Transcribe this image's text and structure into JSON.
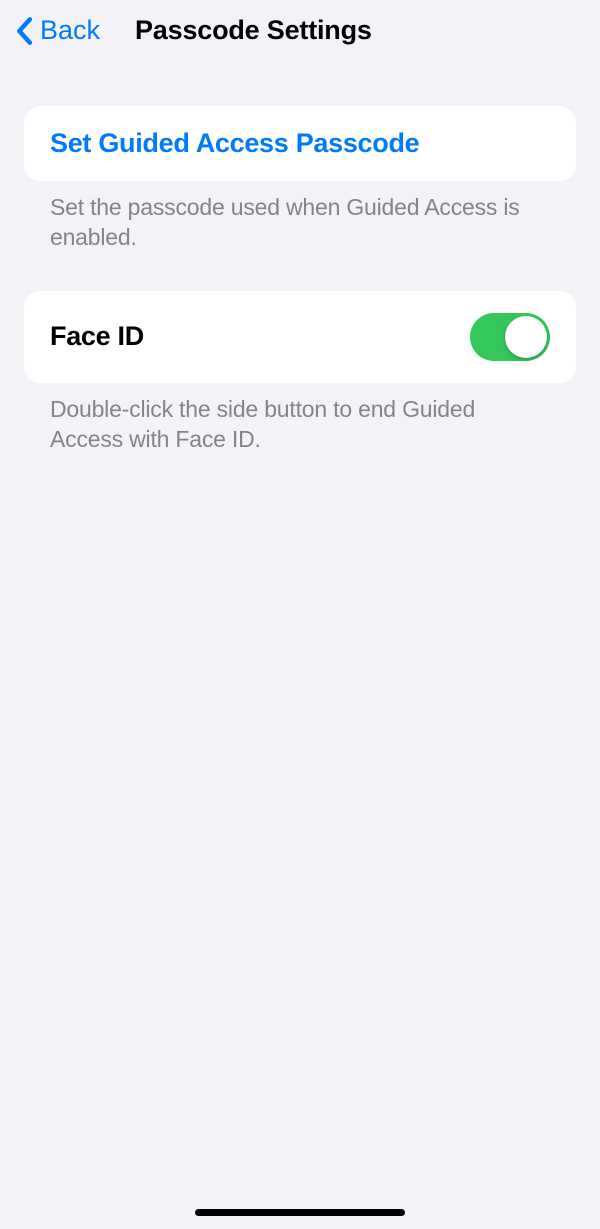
{
  "nav": {
    "back_label": "Back",
    "title": "Passcode Settings"
  },
  "sections": {
    "set_passcode": {
      "label": "Set Guided Access Passcode",
      "footer": "Set the passcode used when Guided Access is enabled."
    },
    "face_id": {
      "label": "Face ID",
      "toggle_on": true,
      "footer": "Double-click the side button to end Guided Access with Face ID."
    }
  }
}
